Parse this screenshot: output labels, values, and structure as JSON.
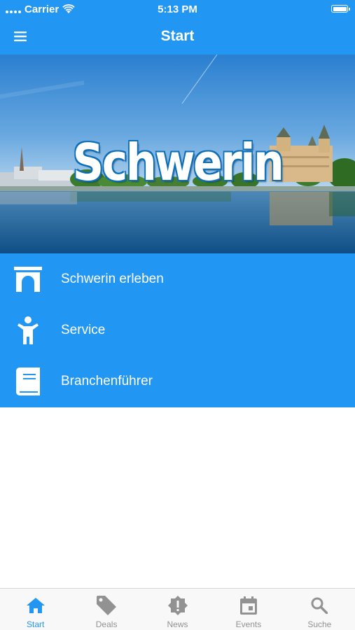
{
  "status_bar": {
    "carrier": "Carrier",
    "time": "5:13 PM"
  },
  "nav": {
    "title": "Start",
    "menu_icon": "hamburger-menu-icon"
  },
  "hero": {
    "title": "Schwerin"
  },
  "menu": {
    "items": [
      {
        "label": "Schwerin erleben",
        "icon": "gate-icon"
      },
      {
        "label": "Service",
        "icon": "person-icon"
      },
      {
        "label": "Branchenführer",
        "icon": "book-icon"
      }
    ]
  },
  "tabbar": {
    "active": "Start",
    "tabs": [
      {
        "label": "Start",
        "icon": "home-icon"
      },
      {
        "label": "Deals",
        "icon": "tag-icon"
      },
      {
        "label": "News",
        "icon": "alert-badge-icon"
      },
      {
        "label": "Events",
        "icon": "calendar-icon"
      },
      {
        "label": "Suche",
        "icon": "search-icon"
      }
    ]
  },
  "colors": {
    "primary": "#2196f3",
    "tab_inactive": "#929292",
    "tab_bar_bg": "#f8f8f8"
  }
}
